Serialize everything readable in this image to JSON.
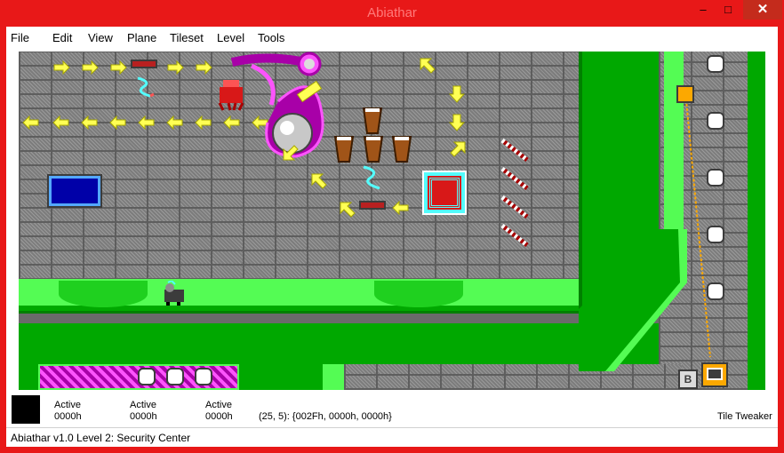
{
  "window": {
    "title": "Abiathar",
    "controls": {
      "minimize": "–",
      "maximize": "□",
      "close": "✕"
    }
  },
  "menu": [
    "File",
    "Edit",
    "View",
    "Plane",
    "Tileset",
    "Level",
    "Tools"
  ],
  "planes": [
    {
      "label": "Active",
      "value": "0000h"
    },
    {
      "label": "Active",
      "value": "0000h"
    },
    {
      "label": "Active",
      "value": "0000h"
    }
  ],
  "cursor_info": "(25, 5): {002Fh, 0000h, 0000h}",
  "tweaker_label": "Tile Tweaker",
  "status": "Abiathar v1.0  Level 2: Security Center",
  "tile_marker": "B",
  "colors": {
    "title_bar": "#e81818",
    "floor_green": "#00a800",
    "highlight_green": "#54fc54",
    "arrow_yellow": "#ffff54"
  },
  "icons": [
    "minimize-icon",
    "maximize-icon",
    "close-icon",
    "arrow-icon",
    "conveyor-icon",
    "claw-icon",
    "sphere-icon",
    "cup-icon",
    "circuit-icon",
    "screen-icon",
    "rod-icon",
    "node-icon",
    "keen-sprite"
  ]
}
